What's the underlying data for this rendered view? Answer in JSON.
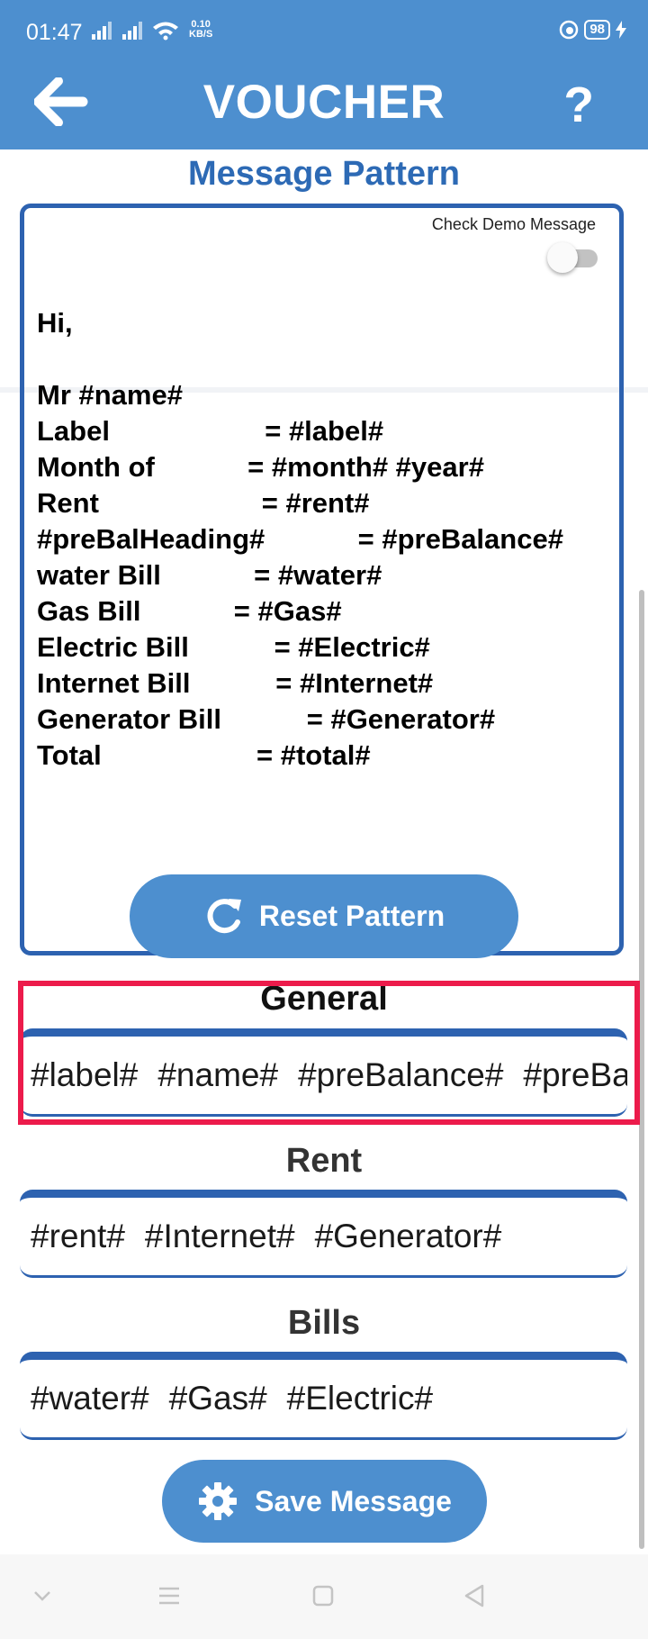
{
  "status_bar": {
    "time": "01:47",
    "network_speed": "0.10",
    "network_speed_unit": "KB/S",
    "battery": "98"
  },
  "header": {
    "title": "VOUCHER",
    "help_label": "?"
  },
  "pattern": {
    "section_title": "Message Pattern",
    "demo_toggle_label": "Check Demo Message",
    "demo_toggle_on": false,
    "message": "Hi,\n\nMr #name#\nLabel                    = #label#\nMonth of            = #month# #year#\nRent                     = #rent#\n#preBalHeading#            = #preBalance#\nwater Bill            = #water#\nGas Bill            = #Gas#\nElectric Bill           = #Electric#\nInternet Bill           = #Internet#\nGenerator Bill           = #Generator#\nTotal                    = #total#",
    "reset_label": "Reset Pattern"
  },
  "categories": [
    {
      "title": "General",
      "tags": [
        "#label#",
        "#name#",
        "#preBalance#",
        "#preBalHeading#"
      ]
    },
    {
      "title": "Rent",
      "tags": [
        "#rent#",
        "#Internet#",
        "#Generator#"
      ]
    },
    {
      "title": "Bills",
      "tags": [
        "#water#",
        "#Gas#",
        "#Electric#"
      ]
    }
  ],
  "save_label": "Save Message",
  "colors": {
    "primary": "#4d8fcf",
    "title_blue": "#2d6ab5",
    "border_blue": "#2d62b0",
    "highlight": "#ec1b4b"
  },
  "icons": {
    "back": "arrow-left-icon",
    "help": "question-mark-icon",
    "reset": "refresh-icon",
    "save": "gear-icon"
  }
}
